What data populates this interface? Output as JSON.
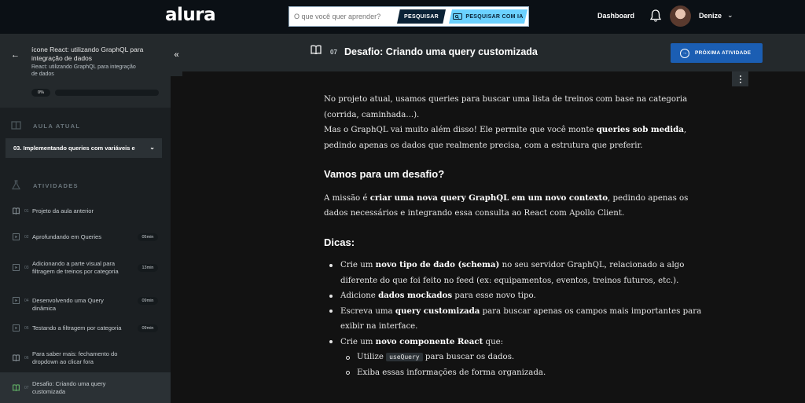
{
  "header": {
    "logo": "alura",
    "search_placeholder": "O que você quer aprender?",
    "search_button": "PESQUISAR",
    "search_ia_button": "PESQUISAR COM IA",
    "dashboard": "Dashboard",
    "username": "Denize"
  },
  "sidebar": {
    "course_title": "ícone React: utilizando GraphQL para integração de dados",
    "course_subtitle": "React: utilizando GraphQL para integração de dados",
    "progress_label": "0%",
    "progress": 0,
    "current_lesson_label": "AULA ATUAL",
    "current_lesson": "03. Implementando queries com variáveis e",
    "activities_label": "ATIVIDADES",
    "activities": [
      {
        "num": "01",
        "title": "Projeto da aula anterior",
        "duration": "",
        "icon": "book-icon",
        "active": false
      },
      {
        "num": "02",
        "title": "Aprofundando em Queries",
        "duration": "05min",
        "icon": "video-icon",
        "active": false
      },
      {
        "num": "03",
        "title": "Adicionando a parte visual para filtragem de treinos por categoria",
        "duration": "13min",
        "icon": "video-icon",
        "active": false
      },
      {
        "num": "04",
        "title": "Desenvolvendo uma Query dinâmica",
        "duration": "09min",
        "icon": "video-icon",
        "active": false
      },
      {
        "num": "05",
        "title": "Testando a filtragem por categoria",
        "duration": "09min",
        "icon": "video-icon",
        "active": false
      },
      {
        "num": "06",
        "title": "Para saber mais: fechamento do dropdown ao clicar fora",
        "duration": "",
        "icon": "book-icon",
        "active": false
      },
      {
        "num": "07",
        "title": "Desafio: Criando uma query customizada",
        "duration": "",
        "icon": "book-icon",
        "active": true
      }
    ]
  },
  "main": {
    "activity_number": "07",
    "activity_title": "Desafio: Criando uma query customizada",
    "next_button": "PRÓXIMA ATIVIDADE",
    "p1_a": "No projeto atual, usamos queries para buscar uma lista de treinos com base na categoria (corrida, caminhada...).",
    "p1_b1": "Mas o GraphQL vai muito além disso! Ele permite que você monte ",
    "p1_b2": "queries sob medida",
    "p1_b3": ", pedindo apenas os dados que realmente precisa, com a estrutura que preferir.",
    "h_desafio": "Vamos para um desafio?",
    "p2_1": "A missão é ",
    "p2_2": "criar uma nova query GraphQL em um novo contexto",
    "p2_3": ", pedindo apenas os dados necessários e integrando essa consulta ao React com Apollo Client.",
    "h_dicas": "Dicas:",
    "tip1_1": "Crie um ",
    "tip1_2": "novo tipo de dado (schema)",
    "tip1_3": " no seu servidor GraphQL, relacionado a algo diferente do que foi feito no feed (ex: equipamentos, eventos, treinos futuros, etc.).",
    "tip2_1": "Adicione ",
    "tip2_2": "dados mockados",
    "tip2_3": " para esse novo tipo.",
    "tip3_1": "Escreva uma ",
    "tip3_2": "query customizada",
    "tip3_3": " para buscar apenas os campos mais importantes para exibir na interface.",
    "tip4_1": "Crie um ",
    "tip4_2": "novo componente React",
    "tip4_3": " que:",
    "sub1_1": "Utilize ",
    "sub1_code": "useQuery",
    "sub1_2": " para buscar os dados.",
    "sub2": "Exiba essas informações de forma organizada."
  }
}
